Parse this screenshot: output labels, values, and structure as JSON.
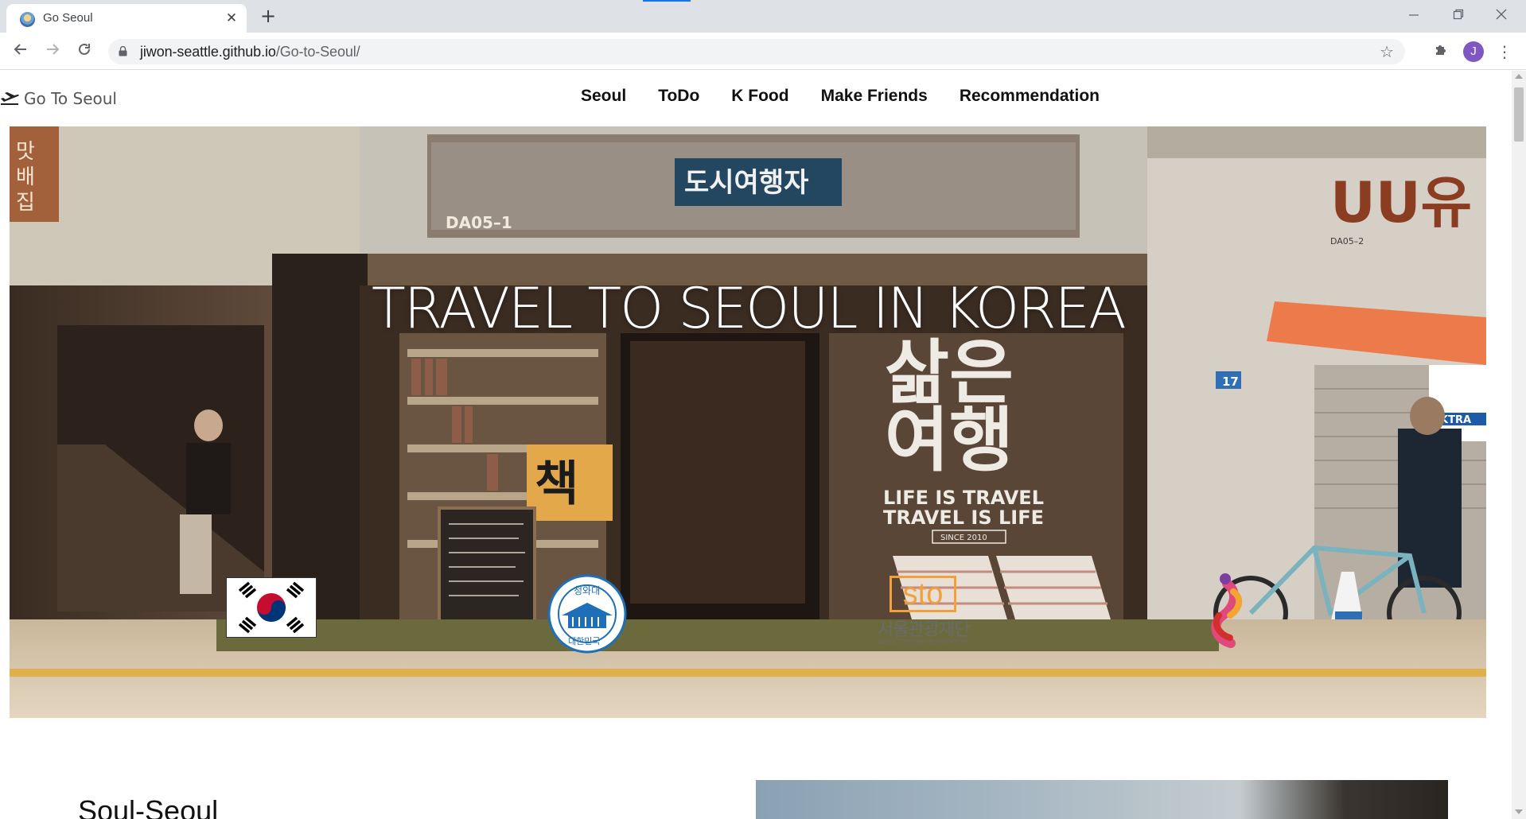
{
  "browser": {
    "tab_title": "Go Seoul",
    "tab_close_glyph": "✕",
    "new_tab_glyph": "+",
    "url_host": "jiwon-seattle.github.io",
    "url_path": "/Go-to-Seoul/",
    "profile_initial": "J",
    "accent_color": "#1a73e8",
    "profile_color": "#7e57c2"
  },
  "site": {
    "brand": "Go To Seoul",
    "nav": [
      {
        "label": "Seoul"
      },
      {
        "label": "ToDo"
      },
      {
        "label": "K Food"
      },
      {
        "label": "Make Friends"
      },
      {
        "label": "Recommendation"
      }
    ]
  },
  "hero": {
    "title": "TRAVEL TO SEOUL IN KOREA",
    "photo_signs": {
      "store_sign": "도시여행자",
      "store_code": "DA05-1",
      "store_code_right": "DA05-2",
      "window_kr_line1": "삶은",
      "window_kr_line2": "여행",
      "window_en_line1": "LIFE IS TRAVEL",
      "window_en_line2": "TRAVEL IS LIFE",
      "window_since": "SINCE 2010",
      "book_sign": "책",
      "street_number": "17",
      "left_sign": "맛배집",
      "right_sign": "KTRA"
    },
    "logos": {
      "cwd_top": "청와대",
      "cwd_bottom": "대한민국",
      "sto_mark": "sto",
      "sto_kr": "서울관광재단",
      "sto_en": "SEOUL TOURISM ORGANIZATION"
    }
  },
  "section": {
    "title": "Soul-Seoul"
  }
}
